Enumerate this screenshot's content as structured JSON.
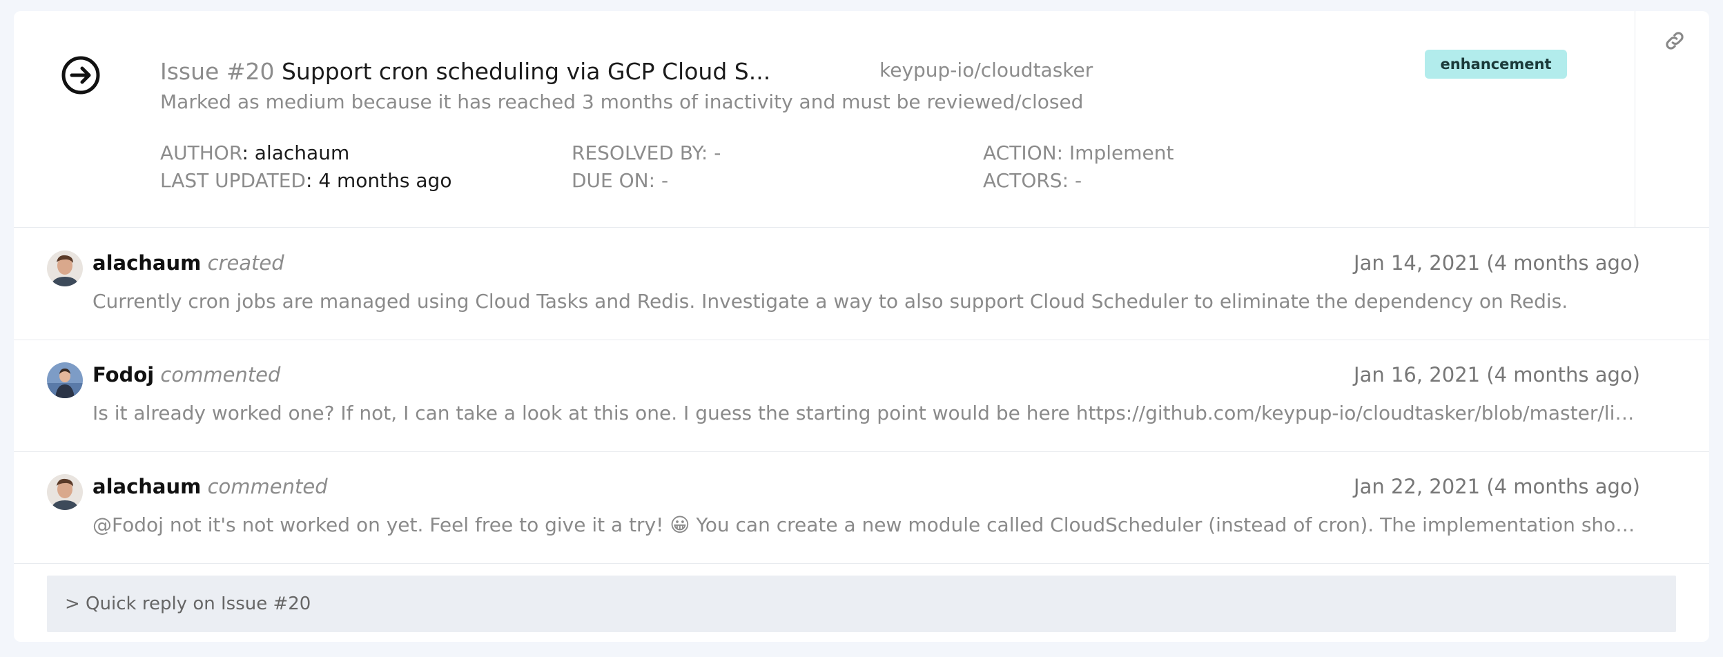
{
  "issue": {
    "number_label": "Issue #20",
    "title": "Support cron scheduling via GCP Cloud S...",
    "repo": "keypup-io/cloudtasker",
    "label": "enhancement",
    "subtitle": "Marked as medium because it has reached 3 months of inactivity and must be reviewed/closed",
    "meta": {
      "author_key": "AUTHOR",
      "author_value": "alachaum",
      "resolved_key": "RESOLVED BY",
      "resolved_value": "-",
      "action_key": "ACTION",
      "action_value": "Implement",
      "updated_key": "LAST UPDATED",
      "updated_value": "4 months ago",
      "due_key": "DUE ON",
      "due_value": "-",
      "actors_key": "ACTORS",
      "actors_value": "-"
    },
    "separator": ":"
  },
  "events": [
    {
      "user": "alachaum",
      "action": "created",
      "date": "Jan 14, 2021 (4 months ago)",
      "body": "Currently cron jobs are managed using Cloud Tasks and Redis. Investigate a way to also support Cloud Scheduler to eliminate the dependency on Redis."
    },
    {
      "user": "Fodoj",
      "action": "commented",
      "date": "Jan 16, 2021 (4 months ago)",
      "body": "Is it already worked one? If not, I can take a look at this one. I guess the starting point would be here https://github.com/keypup-io/cloudtasker/blob/master/lib/..."
    },
    {
      "user": "alachaum",
      "action": "commented",
      "date": "Jan 22, 2021 (4 months ago)",
      "body": "@Fodoj not it's not worked on yet. Feel free to give it a try! 😀 You can create a new module called CloudScheduler (instead of cron). The implementation should be..."
    }
  ],
  "quick_reply": "> Quick reply on Issue #20",
  "icons": {
    "state": "arrow-circle-right-icon",
    "link": "link-icon"
  },
  "colors": {
    "badge_bg": "#b2ecec",
    "muted_text": "#8c8c8c",
    "quick_reply_bg": "#ebeef3"
  }
}
